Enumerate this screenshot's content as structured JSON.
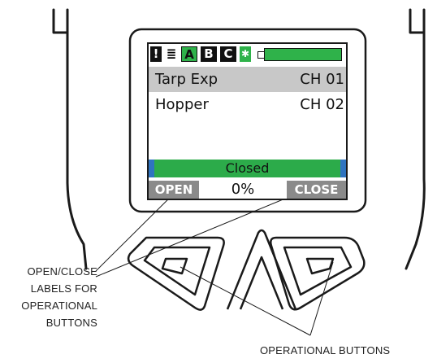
{
  "screen": {
    "status_bar": {
      "alarm_icon": "exclamation-icon",
      "alarm_glyph": "!",
      "level_icon": "stacked-lines-icon",
      "level_glyph": "≣",
      "mode_a": "A",
      "mode_b": "B",
      "mode_c": "C",
      "bluetooth_icon": "bluetooth-icon",
      "bluetooth_glyph": "✱",
      "battery_icon": "battery-icon",
      "battery_level": 1.0
    },
    "channels": [
      {
        "name": "Tarp Exp",
        "channel": "CH 01",
        "selected": true
      },
      {
        "name": "Hopper",
        "channel": "CH 02",
        "selected": false
      }
    ],
    "status": "Closed",
    "softkeys": {
      "left": "OPEN",
      "right": "CLOSE"
    },
    "percent": "0%"
  },
  "callouts": {
    "labels": "OPEN/CLOSE\nLABELS FOR\nOPERATIONAL\nBUTTONS",
    "buttons": "OPERATIONAL BUTTONS"
  },
  "colors": {
    "highlight_green": "#2cab4a",
    "banner_edge_blue": "#2f74c0",
    "softkey_gray": "#8a8a8a",
    "selected_row_gray": "#c8c8c8"
  }
}
